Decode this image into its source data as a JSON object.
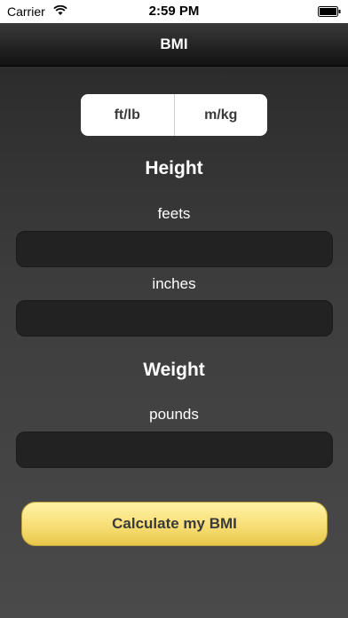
{
  "status_bar": {
    "carrier": "Carrier",
    "time": "2:59 PM"
  },
  "nav": {
    "title": "BMI"
  },
  "units": {
    "imperial_label": "ft/lb",
    "metric_label": "m/kg"
  },
  "height": {
    "title": "Height",
    "feet_label": "feets",
    "feet_value": "",
    "inches_label": "inches",
    "inches_value": ""
  },
  "weight": {
    "title": "Weight",
    "pounds_label": "pounds",
    "pounds_value": ""
  },
  "actions": {
    "calculate_label": "Calculate my BMI"
  },
  "colors": {
    "accent": "#f9e07a",
    "background": "#3d3d3d"
  }
}
